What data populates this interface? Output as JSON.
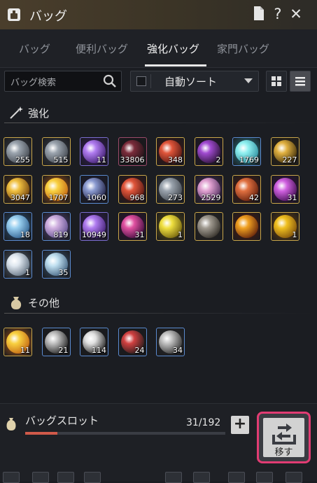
{
  "window": {
    "title": "バッグ",
    "colors": {
      "accent": "#c9a64a",
      "highlight": "#e23c73"
    }
  },
  "tabs": [
    {
      "label": "バッグ"
    },
    {
      "label": "便利バッグ"
    },
    {
      "label": "強化バッグ"
    },
    {
      "label": "家門バッグ"
    }
  ],
  "active_tab": "強化バッグ",
  "search": {
    "placeholder": "バッグ検索"
  },
  "sort": {
    "label": "自動ソート"
  },
  "sections": {
    "enhance": {
      "title": "強化"
    },
    "other": {
      "title": "その他"
    }
  },
  "enhance_items": [
    {
      "count": "255",
      "icon": "grey-stone"
    },
    {
      "count": "515",
      "icon": "grey-stone"
    },
    {
      "count": "11",
      "icon": "purple-gem"
    },
    {
      "count": "33806",
      "icon": "dark-shard"
    },
    {
      "count": "348",
      "icon": "red-stone"
    },
    {
      "count": "2",
      "icon": "purple-claw"
    },
    {
      "count": "1769",
      "icon": "cyan-orb"
    },
    {
      "count": "227",
      "icon": "gold-medal"
    },
    {
      "count": "3047",
      "icon": "gold-coin"
    },
    {
      "count": "1707",
      "icon": "gold-crystal"
    },
    {
      "count": "1060",
      "icon": "blue-stone"
    },
    {
      "count": "968",
      "icon": "red-stone"
    },
    {
      "count": "273",
      "icon": "grey-stone"
    },
    {
      "count": "2529",
      "icon": "pink-crystal"
    },
    {
      "count": "42",
      "icon": "red-egg"
    },
    {
      "count": "31",
      "icon": "purple-egg"
    },
    {
      "count": "18",
      "icon": "blue-orb"
    },
    {
      "count": "819",
      "icon": "pink-orb"
    },
    {
      "count": "10949",
      "icon": "purple-gem"
    },
    {
      "count": "31",
      "icon": "galaxy"
    },
    {
      "count": "1",
      "icon": "gold-gem"
    },
    {
      "count": "",
      "icon": "hammer"
    },
    {
      "count": "",
      "icon": "gold-weapon"
    },
    {
      "count": "1",
      "icon": "gold-egg"
    },
    {
      "count": "1",
      "icon": "silver-orb"
    },
    {
      "count": "35",
      "icon": "crystal-orb"
    }
  ],
  "other_items": [
    {
      "count": "11",
      "icon": "gold-crystal"
    },
    {
      "count": "21",
      "icon": "dark-helm"
    },
    {
      "count": "114",
      "icon": "whip"
    },
    {
      "count": "24",
      "icon": "red-whip"
    },
    {
      "count": "34",
      "icon": "chain"
    }
  ],
  "bag_slot": {
    "label": "バッグスロット",
    "count": "31/192",
    "used": 31,
    "total": 192
  },
  "move_button": {
    "label": "移す"
  }
}
